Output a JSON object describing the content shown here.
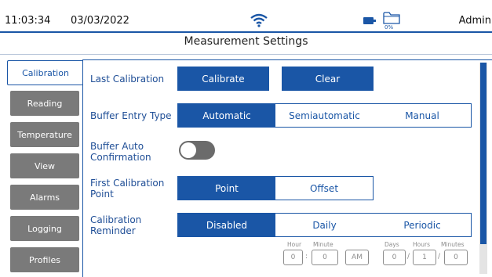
{
  "status": {
    "time": "11:03:34",
    "date": "03/03/2022",
    "storage_pct": "0%",
    "user": "Admin",
    "icons": [
      "wifi-icon",
      "battery-icon",
      "folder-icon"
    ]
  },
  "page_title": "Measurement Settings",
  "tabs": [
    {
      "label": "Calibration",
      "active": true
    },
    {
      "label": "Reading"
    },
    {
      "label": "Temperature"
    },
    {
      "label": "View"
    },
    {
      "label": "Alarms"
    },
    {
      "label": "Logging"
    },
    {
      "label": "Profiles"
    }
  ],
  "settings": {
    "last_calibration": {
      "label": "Last Calibration",
      "calibrate_label": "Calibrate",
      "clear_label": "Clear"
    },
    "buffer_entry_type": {
      "label": "Buffer Entry Type",
      "options": [
        "Automatic",
        "Semiautomatic",
        "Manual"
      ],
      "selected": "Automatic"
    },
    "buffer_auto_confirmation": {
      "label_line1": "Buffer Auto",
      "label_line2": "Confirmation",
      "enabled": false
    },
    "first_calibration_point": {
      "label_line1": "First Calibration",
      "label_line2": "Point",
      "options": [
        "Point",
        "Offset"
      ],
      "selected": "Point"
    },
    "calibration_reminder": {
      "label_line1": "Calibration",
      "label_line2": "Reminder",
      "options": [
        "Disabled",
        "Daily",
        "Periodic"
      ],
      "selected": "Disabled",
      "time_labels": {
        "hour": "Hour",
        "minute": "Minute",
        "days": "Days",
        "hours": "Hours",
        "minutes": "Minutes"
      },
      "values": {
        "hour": "0",
        "minute": "0",
        "ampm": "AM",
        "days": "0",
        "hours": "1",
        "minutes": "0"
      },
      "separators": {
        "time": ":",
        "date": "/"
      }
    }
  },
  "colors": {
    "accent": "#1a56a6",
    "tab_inactive": "#7a7a7a",
    "toggle_off": "#6b6b6b"
  }
}
